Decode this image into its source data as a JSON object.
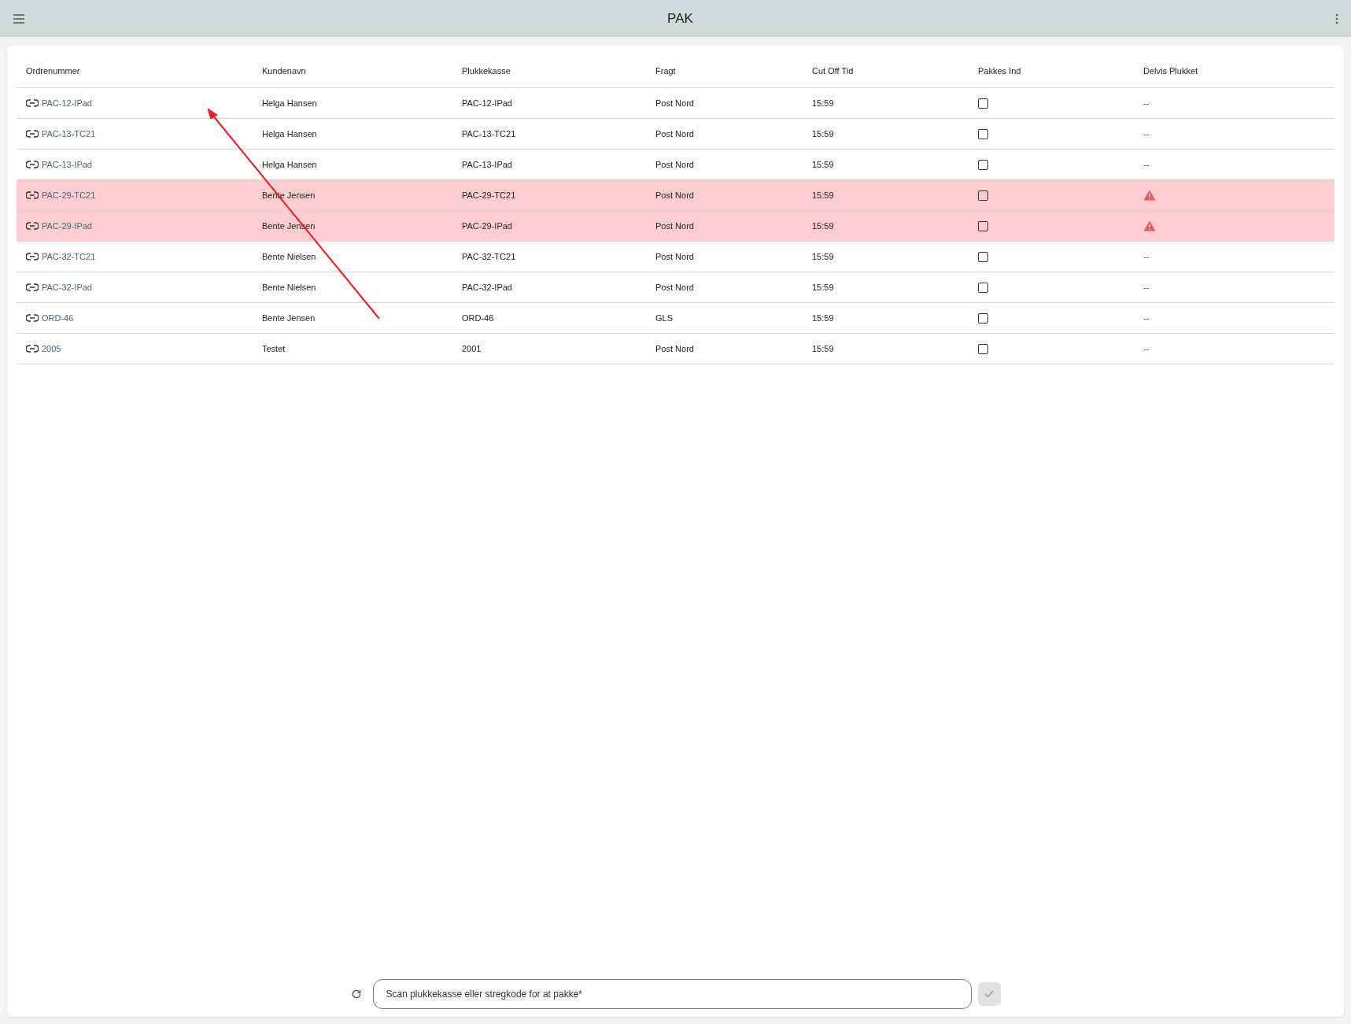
{
  "app_bar": {
    "title": "PAK"
  },
  "table": {
    "columns": [
      "Ordrenummer",
      "Kundenavn",
      "Plukkekasse",
      "Fragt",
      "Cut Off Tid",
      "Pakkes Ind",
      "Delvis Plukket"
    ],
    "rows": [
      {
        "order": "PAC-12-IPad",
        "customer": "Helga Hansen",
        "tote": "PAC-12-IPad",
        "freight": "Post Nord",
        "cutoff": "15:59",
        "pack_in": false,
        "highlighted": false,
        "partial_warning": false,
        "partial": "--"
      },
      {
        "order": "PAC-13-TC21",
        "customer": "Helga Hansen",
        "tote": "PAC-13-TC21",
        "freight": "Post Nord",
        "cutoff": "15:59",
        "pack_in": false,
        "highlighted": false,
        "partial_warning": false,
        "partial": "--"
      },
      {
        "order": "PAC-13-IPad",
        "customer": "Helga Hansen",
        "tote": "PAC-13-IPad",
        "freight": "Post Nord",
        "cutoff": "15:59",
        "pack_in": false,
        "highlighted": false,
        "partial_warning": false,
        "partial": "--"
      },
      {
        "order": "PAC-29-TC21",
        "customer": "Bente Jensen",
        "tote": "PAC-29-TC21",
        "freight": "Post Nord",
        "cutoff": "15:59",
        "pack_in": false,
        "highlighted": true,
        "partial_warning": true
      },
      {
        "order": "PAC-29-IPad",
        "customer": "Bente Jensen",
        "tote": "PAC-29-IPad",
        "freight": "Post Nord",
        "cutoff": "15:59",
        "pack_in": false,
        "highlighted": true,
        "partial_warning": true
      },
      {
        "order": "PAC-32-TC21",
        "customer": "Bente Nielsen",
        "tote": "PAC-32-TC21",
        "freight": "Post Nord",
        "cutoff": "15:59",
        "pack_in": false,
        "highlighted": false,
        "partial_warning": false,
        "partial": "--"
      },
      {
        "order": "PAC-32-IPad",
        "customer": "Bente Nielsen",
        "tote": "PAC-32-IPad",
        "freight": "Post Nord",
        "cutoff": "15:59",
        "pack_in": false,
        "highlighted": false,
        "partial_warning": false,
        "partial": "--"
      },
      {
        "order": "ORD-46",
        "customer": "Bente Jensen",
        "tote": "ORD-46",
        "freight": "GLS",
        "cutoff": "15:59",
        "pack_in": false,
        "highlighted": false,
        "partial_warning": false,
        "partial": "--"
      },
      {
        "order": "2005",
        "customer": "Testet",
        "tote": "2001",
        "freight": "Post Nord",
        "cutoff": "15:59",
        "pack_in": false,
        "highlighted": false,
        "partial_warning": false,
        "partial": "--"
      }
    ]
  },
  "scan": {
    "placeholder": "Scan plukkekasse eller stregkode for at pakke*"
  }
}
